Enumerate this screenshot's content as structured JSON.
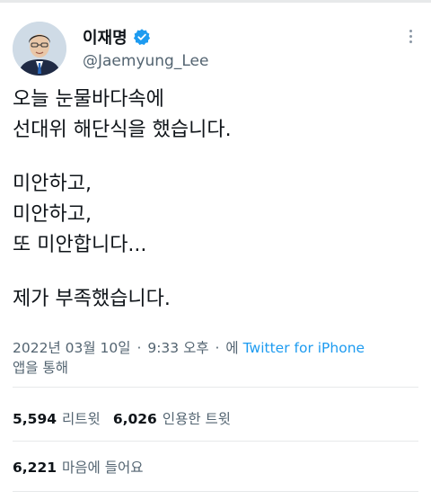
{
  "account": {
    "display_name": "이재명",
    "handle": "@Jaemyung_Lee"
  },
  "tweet": {
    "lines": [
      "오늘 눈물바다속에",
      "선대위 해단식을 했습니다.",
      "",
      "미안하고,",
      "미안하고,",
      "또 미안합니다...",
      "",
      "제가 부족했습니다."
    ]
  },
  "meta": {
    "date": "2022년 03월 10일",
    "time": "9:33 오후",
    "via_prefix": "에",
    "source": "Twitter for iPhone",
    "via_suffix": "앱을 통해"
  },
  "stats": {
    "retweets_count": "5,594",
    "retweets_label": "리트윗",
    "quotes_count": "6,026",
    "quotes_label": "인용한 트윗",
    "likes_count": "6,221",
    "likes_label": "마음에 들어요"
  },
  "colors": {
    "link": "#1d9bf0",
    "verified": "#1d9bf0",
    "muted_text": "#536471",
    "divider": "#e7e9ea"
  },
  "icons": {
    "verified": "verified-badge-icon",
    "more": "more-options-icon"
  }
}
